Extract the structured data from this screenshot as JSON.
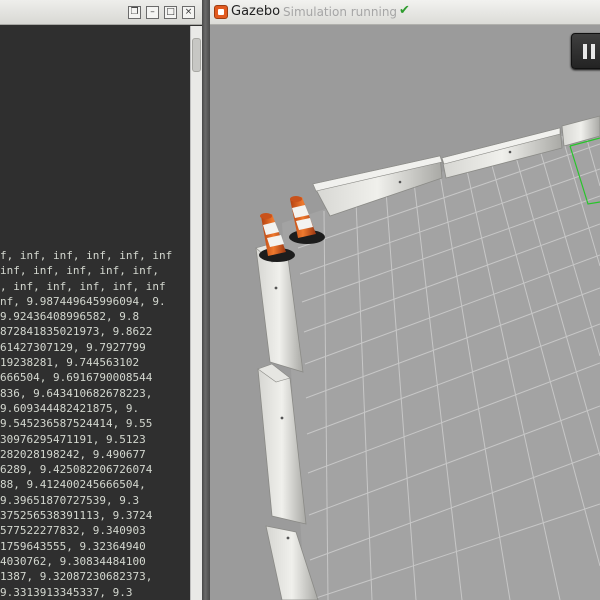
{
  "terminal": {
    "window_buttons": [
      "restore-icon",
      "minimize-icon",
      "maximize-icon",
      "close-icon"
    ],
    "lines": [
      "f, inf, inf, inf, inf, inf",
      "inf, inf, inf, inf, inf,",
      ", inf, inf, inf, inf, inf",
      "nf, 9.987449645996094, 9.",
      "9.92436408996582, 9.8",
      "872841835021973, 9.8622",
      "61427307129, 9.7927799",
      "19238281, 9.744563102",
      "666504, 9.6916790008544",
      "836, 9.643410682678223,",
      "9.609344482421875, 9.",
      "9.545236587524414, 9.55",
      "30976295471191, 9.5123",
      "282028198242, 9.490677",
      "6289, 9.425082206726074",
      "88, 9.412400245666504,",
      "9.39651870727539, 9.3",
      "375256538391113, 9.3724",
      "577522277832, 9.340903",
      "1759643555, 9.32364940",
      "4030762, 9.30834484100",
      "1387, 9.32087230682373,",
      "9.3313913345337, 9.3"
    ]
  },
  "gazebo": {
    "app_name": "Gazebo",
    "status": "Simulation running",
    "status_icon": "checkmark-icon",
    "accent": "#2e9c2e",
    "pause_icon": "pause-icon"
  }
}
